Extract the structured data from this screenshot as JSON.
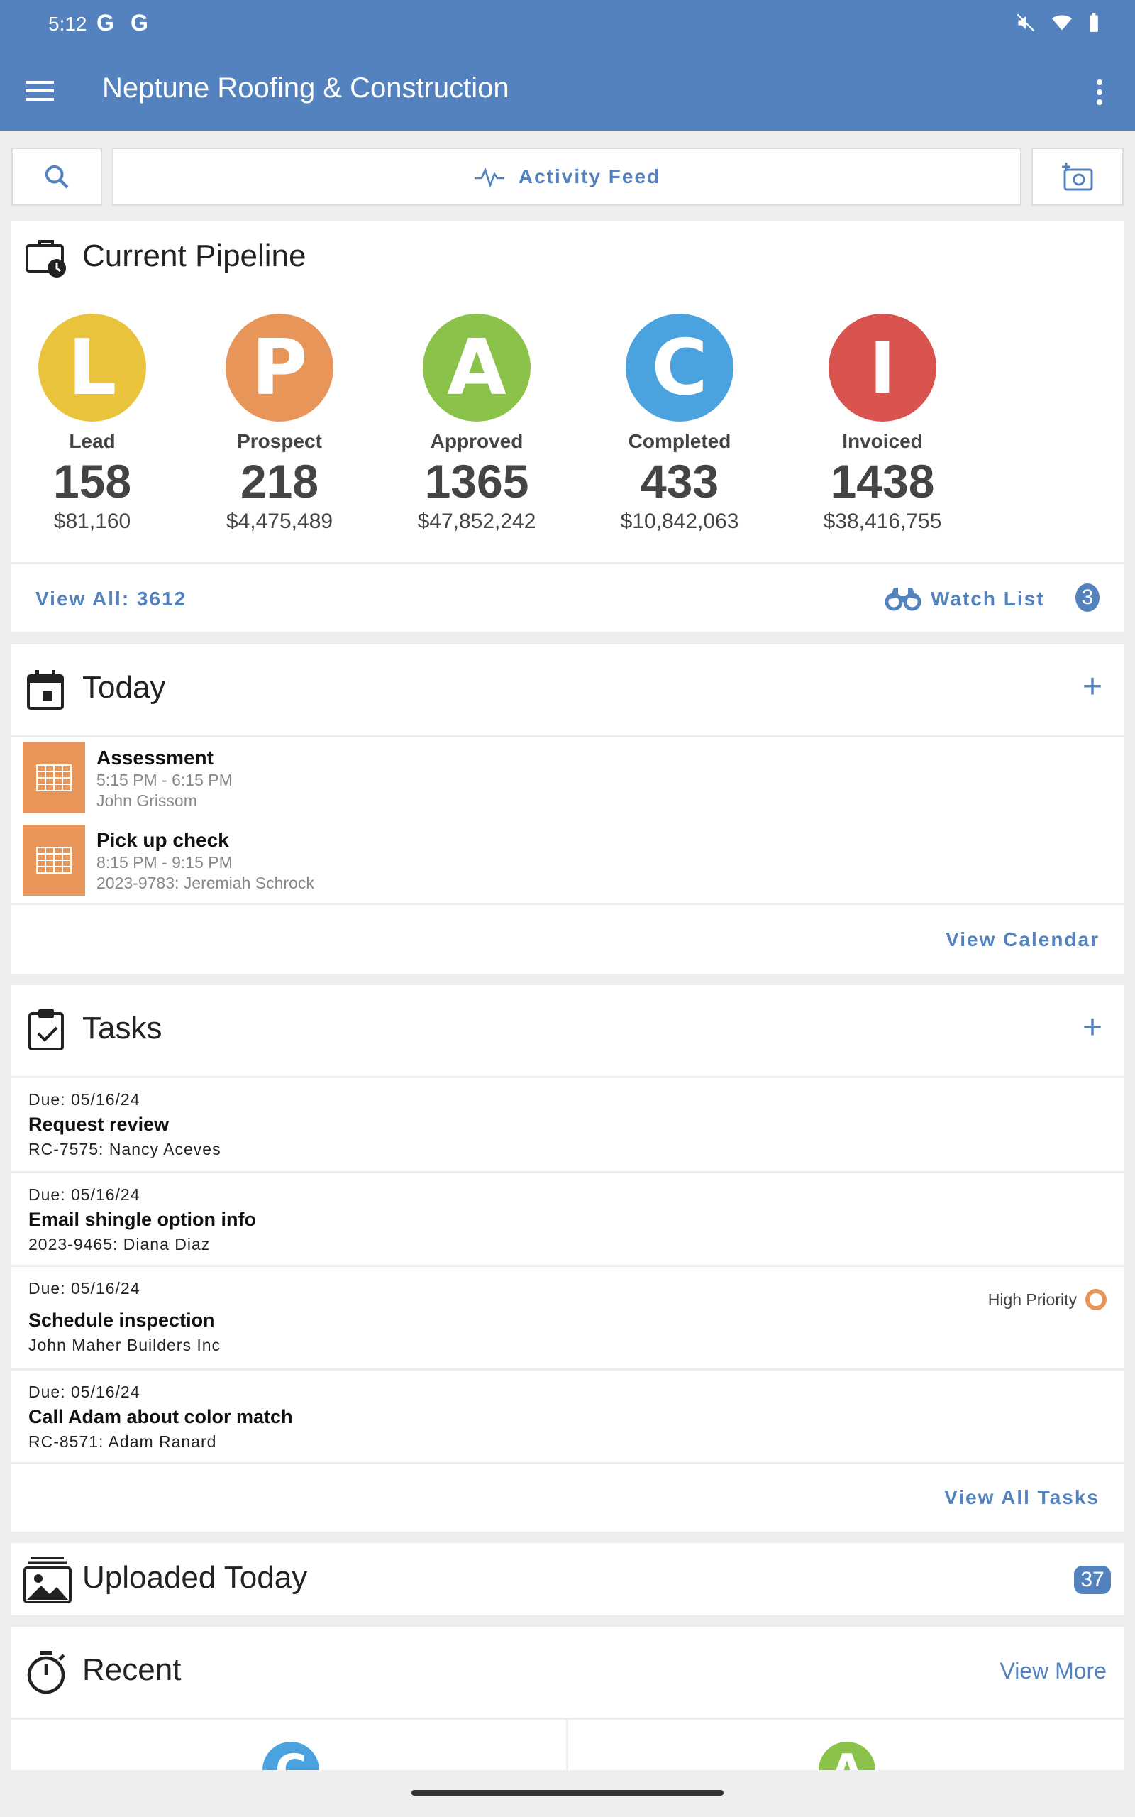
{
  "status": {
    "time": "5:12",
    "g1": "G",
    "g2": "G"
  },
  "appbar": {
    "title": "Neptune Roofing & Construction"
  },
  "toolbar": {
    "activity_feed": "Activity Feed"
  },
  "pipeline": {
    "title": "Current Pipeline",
    "stages": [
      {
        "letter": "L",
        "label": "Lead",
        "count": "158",
        "amount": "$81,160",
        "color": "#e9c33c"
      },
      {
        "letter": "P",
        "label": "Prospect",
        "count": "218",
        "amount": "$4,475,489",
        "color": "#e8955a"
      },
      {
        "letter": "A",
        "label": "Approved",
        "count": "1365",
        "amount": "$47,852,242",
        "color": "#8bc34a"
      },
      {
        "letter": "C",
        "label": "Completed",
        "count": "433",
        "amount": "$10,842,063",
        "color": "#4aa3df"
      },
      {
        "letter": "I",
        "label": "Invoiced",
        "count": "1438",
        "amount": "$38,416,755",
        "color": "#d9534f"
      }
    ],
    "view_all": "View All: 3612",
    "watch_list": "Watch List",
    "watch_count": "3"
  },
  "today": {
    "title": "Today",
    "events": [
      {
        "title": "Assessment",
        "time": "5:15 PM - 6:15 PM",
        "person": "John Grissom"
      },
      {
        "title": "Pick up check",
        "time": "8:15 PM - 9:15 PM",
        "person": "2023-9783: Jeremiah Schrock"
      }
    ],
    "view_calendar": "View Calendar"
  },
  "tasks": {
    "title": "Tasks",
    "items": [
      {
        "due": "Due: 05/16/24",
        "title": "Request review",
        "sub": "RC-7575: Nancy Aceves"
      },
      {
        "due": "Due: 05/16/24",
        "title": "Email shingle option info",
        "sub": "2023-9465: Diana Diaz"
      },
      {
        "due": "Due: 05/16/24",
        "title": "Schedule inspection",
        "sub": "John Maher Builders Inc",
        "priority": "High Priority"
      },
      {
        "due": "Due: 05/16/24",
        "title": "Call Adam about color match",
        "sub": "RC-8571: Adam Ranard"
      }
    ],
    "view_all": "View All Tasks"
  },
  "uploaded": {
    "title": "Uploaded Today",
    "count": "37"
  },
  "recent": {
    "title": "Recent",
    "view_more": "View More",
    "letters": [
      "C",
      "A"
    ]
  },
  "colors": {
    "primary": "#5482be",
    "orange": "#e8955a"
  }
}
